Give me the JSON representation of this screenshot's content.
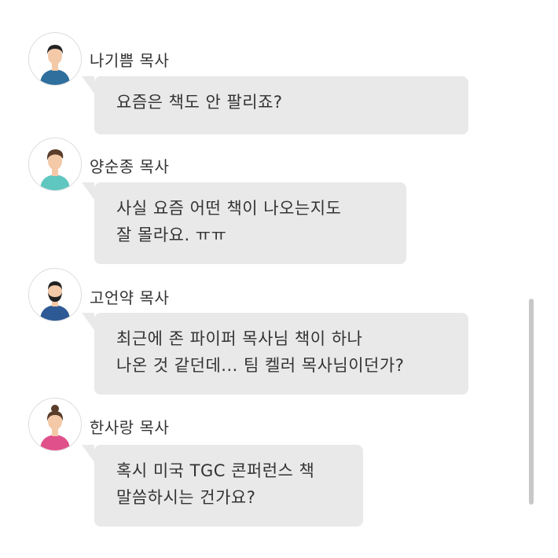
{
  "messages": [
    {
      "sender": "나기쁨 목사",
      "lines": [
        "요즘은 책도 안 팔리죠?"
      ],
      "avatar": "man-short-black-hair-avatar-icon",
      "shirt_color": "#2e6f9e"
    },
    {
      "sender": "양순종 목사",
      "lines": [
        "사실 요즘 어떤 책이 나오는지도",
        "잘 몰라요. ㅠㅠ"
      ],
      "avatar": "man-brown-hair-avatar-icon",
      "shirt_color": "#5fc6c0"
    },
    {
      "sender": "고언약 목사",
      "lines": [
        "최근에 존 파이퍼 목사님 책이 하나",
        "나온 것 같던데... 팀 켈러 목사님이던가?"
      ],
      "avatar": "bearded-man-avatar-icon",
      "shirt_color": "#2d5a94"
    },
    {
      "sender": "한사랑 목사",
      "lines": [
        "혹시 미국 TGC 콘퍼런스 책",
        "말씀하시는 건가요?"
      ],
      "avatar": "woman-hair-bun-avatar-icon",
      "shirt_color": "#e0508a"
    }
  ],
  "colors": {
    "bubble": "#e9e9e9",
    "scrollbar": "#c8c8c8"
  }
}
